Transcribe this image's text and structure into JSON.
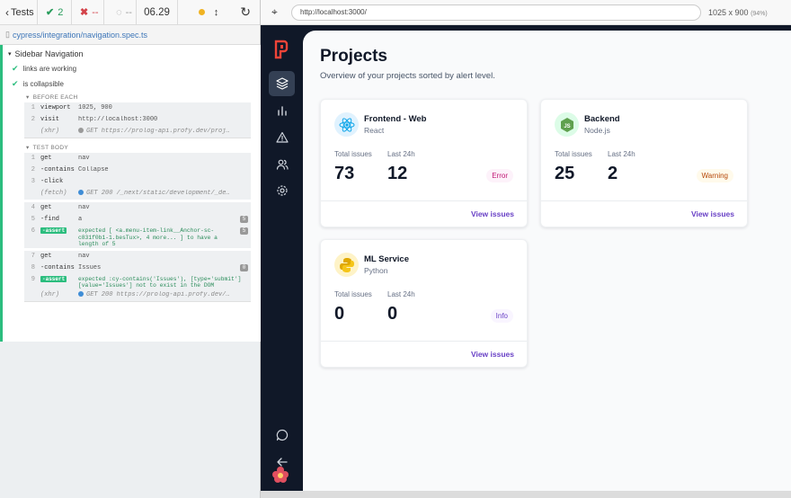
{
  "reporter": {
    "tests_label": "Tests",
    "passed": "2",
    "failed": "--",
    "pending": "--",
    "timer": "06.29",
    "spec_path": "cypress/integration/navigation.spec.ts",
    "suite_title": "Sidebar Navigation",
    "tests": [
      {
        "title": "links are working"
      },
      {
        "title": "is collapsible"
      }
    ],
    "before_each_label": "BEFORE EACH",
    "test_body_label": "TEST BODY",
    "before_each": [
      {
        "num": "1",
        "name": "viewport",
        "msg": "1025, 900"
      },
      {
        "num": "2",
        "name": "visit",
        "msg": "http://localhost:3000"
      },
      {
        "num": "",
        "name": "(xhr)",
        "msg": "GET https://prolog-api.profy.dev/proj…"
      }
    ],
    "body": [
      {
        "num": "1",
        "name": "get",
        "msg": "nav"
      },
      {
        "num": "2",
        "name": "-contains",
        "msg": "Collapse"
      },
      {
        "num": "3",
        "name": "-click",
        "msg": ""
      },
      {
        "num": "",
        "name": "(fetch)",
        "msg": "GET 200 /_next/static/development/_de…"
      },
      {
        "num": "4",
        "name": "get",
        "msg": "nav"
      },
      {
        "num": "5",
        "name": "-find",
        "msg": "a",
        "count": "5"
      },
      {
        "num": "6",
        "name": "-assert",
        "msg": "expected [ <a.menu-item-link__Anchor-sc-c831f0b1-1.besTux>, 4 more... ] to have a length of 5",
        "count": "5"
      },
      {
        "num": "7",
        "name": "get",
        "msg": "nav"
      },
      {
        "num": "8",
        "name": "-contains",
        "msg": "Issues",
        "count": "0"
      },
      {
        "num": "9",
        "name": "-assert",
        "msg": "expected :cy-contains('Issues'), [type='submit'][value='Issues'] not to exist in the DOM"
      },
      {
        "num": "",
        "name": "(xhr)",
        "msg": "GET 200 https://prolog-api.profy.dev/…"
      }
    ]
  },
  "browser": {
    "url": "http://localhost:3000/",
    "viewport": "1025 x 900",
    "zoom": "(94%)"
  },
  "app": {
    "title": "Projects",
    "subtitle": "Overview of your projects sorted by alert level.",
    "total_label": "Total issues",
    "last24_label": "Last 24h",
    "view_label": "View issues",
    "projects": [
      {
        "name": "Frontend - Web",
        "language": "React",
        "total": "73",
        "last24": "12",
        "status": "Error",
        "icon": "react-icon",
        "status_color": "#c11574",
        "status_bg": "#fdf2fa"
      },
      {
        "name": "Backend",
        "language": "Node.js",
        "total": "25",
        "last24": "2",
        "status": "Warning",
        "icon": "nodejs-icon",
        "status_color": "#b54708",
        "status_bg": "#fffaeb"
      },
      {
        "name": "ML Service",
        "language": "Python",
        "total": "0",
        "last24": "0",
        "status": "Info",
        "icon": "python-icon",
        "status_color": "#6941c6",
        "status_bg": "#f9f5ff"
      }
    ],
    "nav_items": [
      "projects-icon",
      "issues-chart-icon",
      "alerts-icon",
      "users-icon",
      "settings-icon"
    ],
    "nav_footer": [
      "support-icon",
      "collapse-arrow-icon"
    ]
  }
}
